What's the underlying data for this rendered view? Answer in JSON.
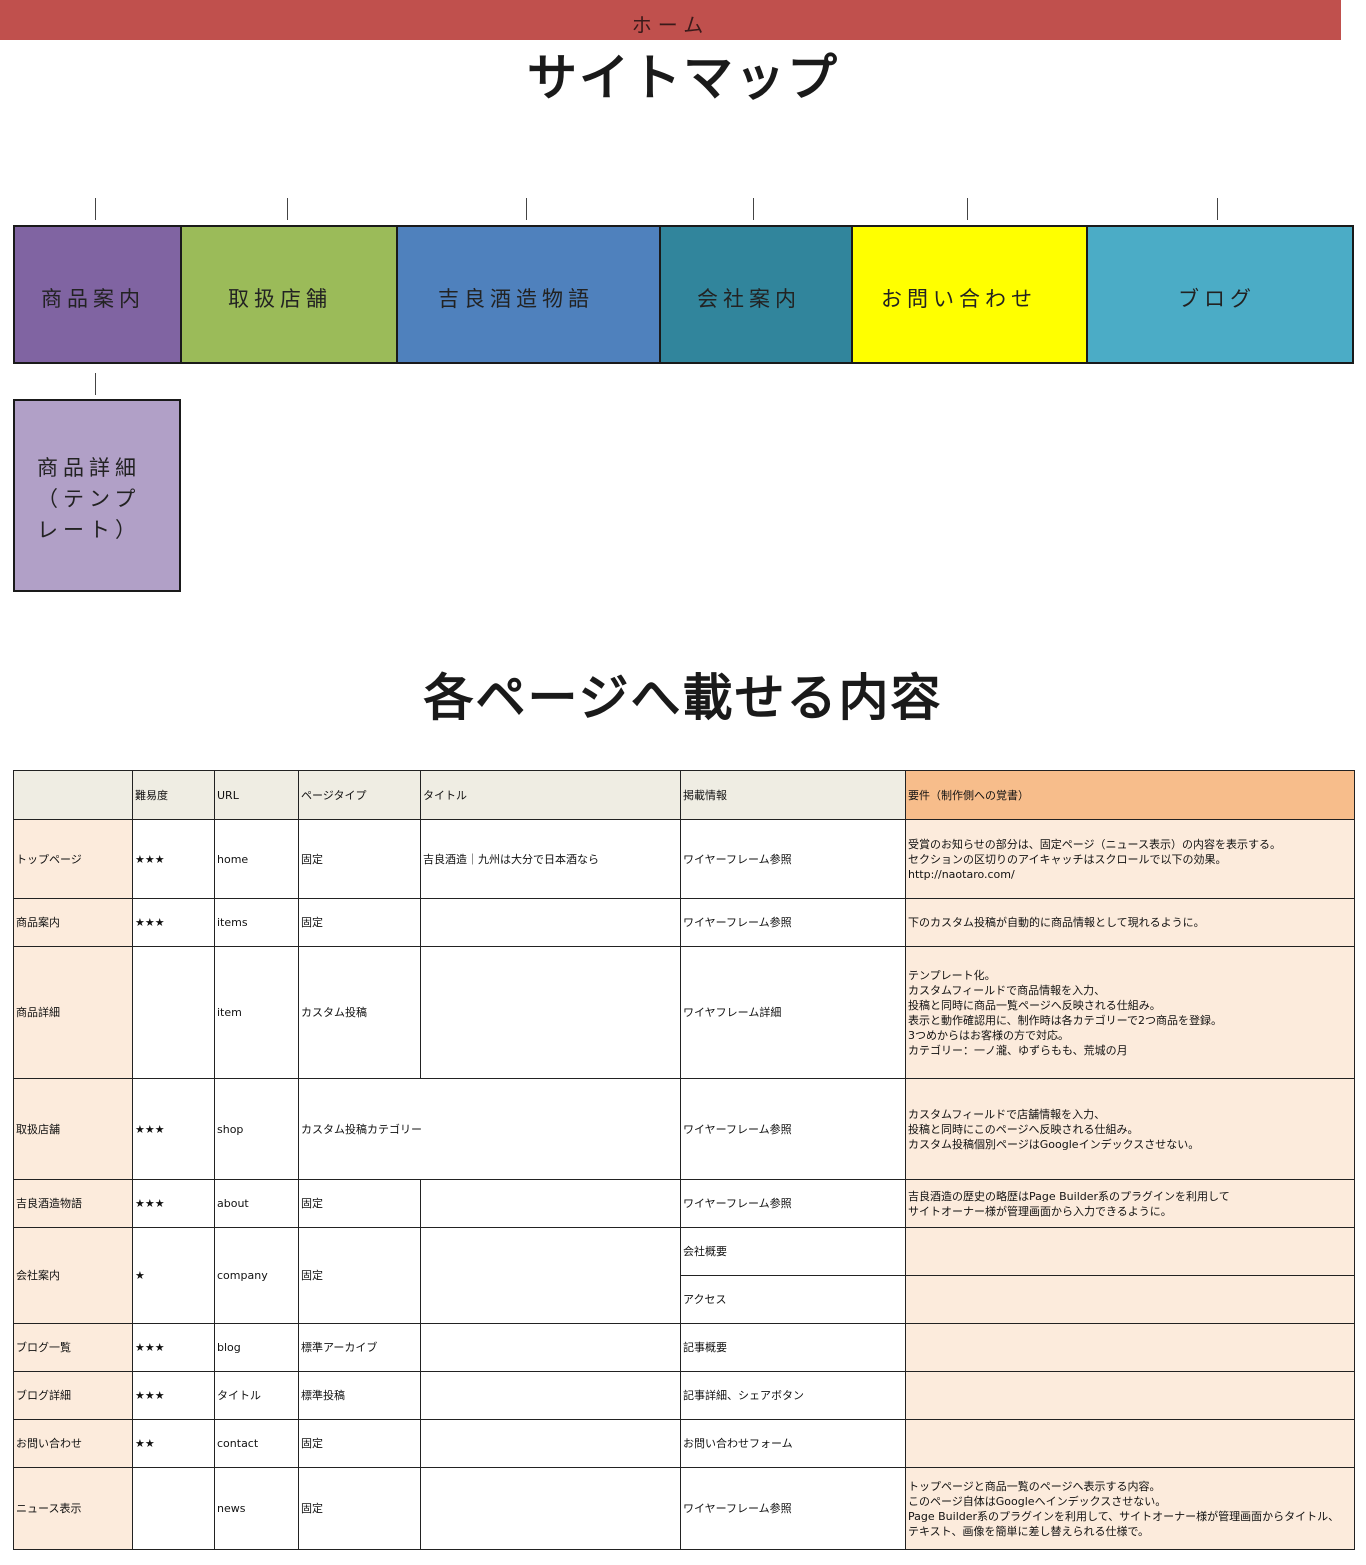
{
  "sitemap": {
    "title": "サイトマップ",
    "home": "ホーム",
    "sections": [
      {
        "label": "商品案内",
        "color": "#8064a2"
      },
      {
        "label": "取扱店舗",
        "color": "#9bbb59"
      },
      {
        "label": "吉良酒造物語",
        "color": "#4f81bd"
      },
      {
        "label": "会社案内",
        "color": "#31859c"
      },
      {
        "label": "お問い合わせ",
        "color": "#ffff00"
      },
      {
        "label": "ブログ",
        "color": "#4bacc6"
      }
    ],
    "child": {
      "label": "商品詳細（テンプレート）",
      "color": "#b1a0c7"
    }
  },
  "pages_section": {
    "title": "各ページへ載せる内容",
    "headers": [
      "",
      "難易度",
      "URL",
      "ページタイプ",
      "タイトル",
      "掲載情報",
      "要件（制作側への覚書）"
    ],
    "rows": [
      {
        "name": "トップページ",
        "difficulty": "★★★",
        "url": "home",
        "type": "固定",
        "title": "吉良酒造｜九州は大分で日本酒なら",
        "info": "ワイヤーフレーム参照",
        "notes": "受賞のお知らせの部分は、固定ページ（ニュース表示）の内容を表示する。\nセクションの区切りのアイキャッチはスクロールで以下の効果。\nhttp://naotaro.com/"
      },
      {
        "name": "商品案内",
        "difficulty": "★★★",
        "url": "items",
        "type": "固定",
        "title": "",
        "info": "ワイヤーフレーム参照",
        "notes": "下のカスタム投稿が自動的に商品情報として現れるように。"
      },
      {
        "name": "商品詳細",
        "difficulty": "",
        "url": "item",
        "type": "カスタム投稿",
        "title": "",
        "info": "ワイヤフレーム詳細",
        "notes": "テンプレート化。\nカスタムフィールドで商品情報を入力、\n投稿と同時に商品一覧ページへ反映される仕組み。\n表示と動作確認用に、制作時は各カテゴリーで2つ商品を登録。\n3つめからはお客様の方で対応。\nカテゴリー：一ノ瀧、ゆずらもも、荒城の月"
      },
      {
        "name": "取扱店舗",
        "difficulty": "★★★",
        "url": "shop",
        "type": "カスタム投稿カテゴリー",
        "title": "",
        "info": "ワイヤーフレーム参照",
        "notes": "カスタムフィールドで店舗情報を入力、\n投稿と同時にこのページへ反映される仕組み。\nカスタム投稿個別ページはGoogleインデックスさせない。"
      },
      {
        "name": "吉良酒造物語",
        "difficulty": "★★★",
        "url": "about",
        "type": "固定",
        "title": "",
        "info": "ワイヤーフレーム参照",
        "notes": "吉良酒造の歴史の略歴はPage Builder系のプラグインを利用して\nサイトオーナー様が管理画面から入力できるように。"
      },
      {
        "name": "会社案内",
        "difficulty": "★",
        "url": "company",
        "type": "固定",
        "title": "",
        "info": "会社概要",
        "info2": "アクセス",
        "notes": ""
      },
      {
        "name": "ブログ一覧",
        "difficulty": "★★★",
        "url": "blog",
        "type": "標準アーカイブ",
        "title": "",
        "info": "記事概要",
        "notes": ""
      },
      {
        "name": "ブログ詳細",
        "difficulty": "★★★",
        "url": "タイトル",
        "type": "標準投稿",
        "title": "",
        "info": "記事詳細、シェアボタン",
        "notes": ""
      },
      {
        "name": "お問い合わせ",
        "difficulty": "★★",
        "url": "contact",
        "type": "固定",
        "title": "",
        "info": "お問い合わせフォーム",
        "notes": ""
      },
      {
        "name": "ニュース表示",
        "difficulty": "",
        "url": "news",
        "type": "固定",
        "title": "",
        "info": "ワイヤーフレーム参照",
        "notes": "トップページと商品一覧のページへ表示する内容。\nこのページ自体はGoogleへインデックスさせない。\nPage Builder系のプラグインを利用して、サイトオーナー様が管理画面からタイトル、\nテキスト、画像を簡単に差し替えられる仕様で。"
      }
    ]
  }
}
